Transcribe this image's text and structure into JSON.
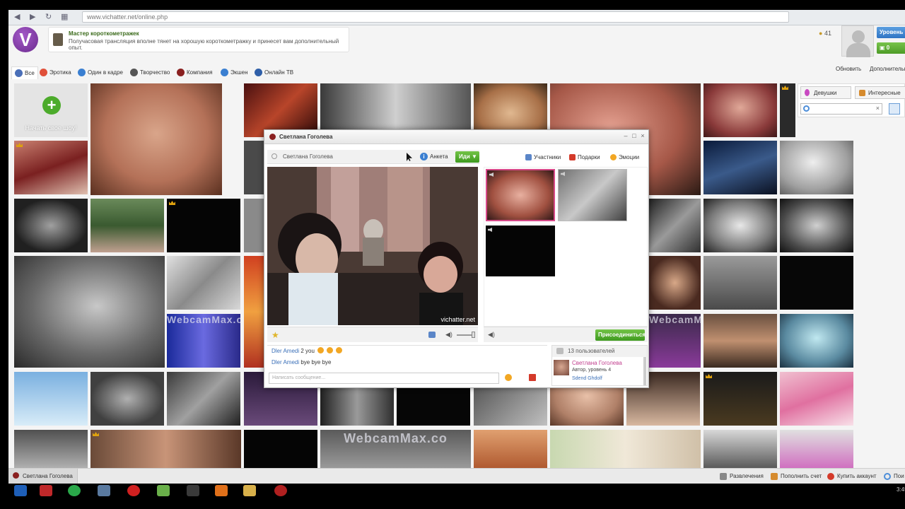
{
  "browser": {
    "url": "www.vichatter.net/online.php"
  },
  "header": {
    "logo_letter": "V",
    "notice_title": "Мастер короткометражек",
    "notice_text": "Получасовая трансляция вполне тянет на хорошую короткометражку и принесет вам дополнительный опыт.",
    "users_count": "41",
    "level_label": "Уровень",
    "coins_label": "0",
    "refresh_label": "Обновить",
    "more_label": "Дополнительно"
  },
  "tabs": [
    {
      "label": "Все",
      "color": "#4a6fb8"
    },
    {
      "label": "Эротика",
      "color": "#e0503a"
    },
    {
      "label": "Один в кадре",
      "color": "#3a7fd1"
    },
    {
      "label": "Творчество",
      "color": "#555555"
    },
    {
      "label": "Компания",
      "color": "#8a2020"
    },
    {
      "label": "Экшен",
      "color": "#3a7fd1"
    },
    {
      "label": "Онлайн ТВ",
      "color": "#2f5fa8"
    }
  ],
  "filters": {
    "girls_label": "Девушки",
    "interesting_label": "Интересные",
    "search_value": ""
  },
  "start_show_label": "Начать свое шоу!",
  "watermarks": {
    "wm1": "WebcamMax.co",
    "wm2": "WebcamMax.co",
    "wm3": "WebcamMax.co",
    "wm4": "WebcamMax.co"
  },
  "window": {
    "title": "Светлана Гоголева",
    "broadcaster_name": "Светлана Гоголева",
    "profile_button": "Анкета",
    "go_button": "Иди ▼",
    "video_watermark": "vichatter.net",
    "side_tabs": {
      "participants": "Участники",
      "gifts": "Подарки",
      "emotions": "Эмоции"
    },
    "join_button": "Присоединиться",
    "chat": [
      {
        "user": "Dler Amedi",
        "text": "2 you"
      },
      {
        "user": "Dler Amedi",
        "text": "bye bye bye"
      }
    ],
    "chat_placeholder": "Написать сообщение...",
    "users_panel_header": "13 пользователей",
    "users_panel_name": "Светлана Гоголева",
    "users_panel_role": "Автор, уровень 4",
    "users_panel_next": "Sdend Ghdolf"
  },
  "statusbar": {
    "active_item": "Светлана Гоголева",
    "entertainment": "Развлечения",
    "top_up": "Пополнить счет",
    "buy_account": "Купить аккаунт",
    "search": "Пои"
  },
  "taskbar": {
    "clock": "3:45"
  },
  "colors": {
    "brand_purple": "#6b2a8e",
    "accent_green": "#4cab2b",
    "link_blue": "#3a6fb8"
  }
}
